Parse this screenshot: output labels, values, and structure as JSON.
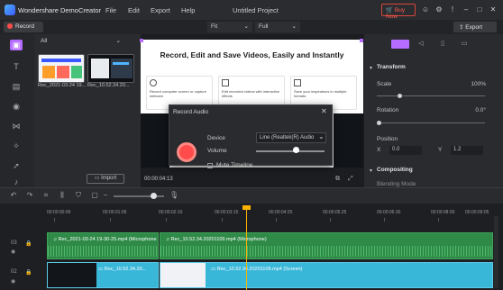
{
  "app": {
    "name": "Wondershare DemoCreator",
    "project_title": "Untitled Project"
  },
  "menu": [
    "File",
    "Edit",
    "Export",
    "Help"
  ],
  "header": {
    "buy_now": "Buy Now"
  },
  "toolbar": {
    "record_label": "Record",
    "fit": "Fit",
    "full": "Full",
    "export_label": "Export"
  },
  "library": {
    "filter": "All",
    "items": [
      {
        "caption": "Rec_2021-03-24 19..."
      },
      {
        "caption": "Rec_10.52.34.20..."
      }
    ],
    "import_label": "Import"
  },
  "preview": {
    "heading": "Record, Edit and Save Videos, Easily and Instantly",
    "cards": [
      {
        "title": "Record computer screen or capture webcam"
      },
      {
        "title": "Edit recorded videos with interactive effects"
      },
      {
        "title": "Save your inspirations in multiple formats"
      }
    ],
    "timecode": "00:00:04:13"
  },
  "dialog": {
    "title": "Record Audio",
    "device_label": "Device",
    "device_value": "Line (Realtek(R) Audio",
    "volume_label": "Volume",
    "volume_level": 0.6,
    "mute_label": "Mute Timeline"
  },
  "properties": {
    "transform": "Transform",
    "scale_label": "Scale",
    "scale_value": "100%",
    "rotation_label": "Rotation",
    "rotation_value": "0.0°",
    "position_label": "Position",
    "x_label": "X",
    "x_value": "0.0",
    "y_label": "Y",
    "y_value": "1.2",
    "compositing": "Compositing",
    "blending_label": "Blending Mode"
  },
  "timeline": {
    "ruler": [
      "00:00:00:00",
      "00:00:01:05",
      "00:00:02:10",
      "00:00:03:15",
      "00:00:04:20",
      "00:00:05:25",
      "00:00:06:30",
      "00:00:08:00",
      "00:00:09:05"
    ],
    "tracks": [
      {
        "number": "03"
      },
      {
        "number": "02"
      }
    ],
    "audio_clips": [
      {
        "label": "Rec_2021-03-24 19-30-25.mp4 (Microphone"
      },
      {
        "label": "Rec_10.52.34.20201109.mp4 (Microphone)"
      }
    ],
    "video_clips": [
      {
        "label": "Rec_10.52.34.20..."
      },
      {
        "label": "Rec_10.52.34.20201109.mp4 (Screen)"
      }
    ]
  },
  "colors": {
    "accent": "#b56cff",
    "record": "#ff4b4b",
    "audio_clip": "#2f8a48",
    "video_clip": "#39b7d9",
    "playhead": "#ffb300"
  }
}
